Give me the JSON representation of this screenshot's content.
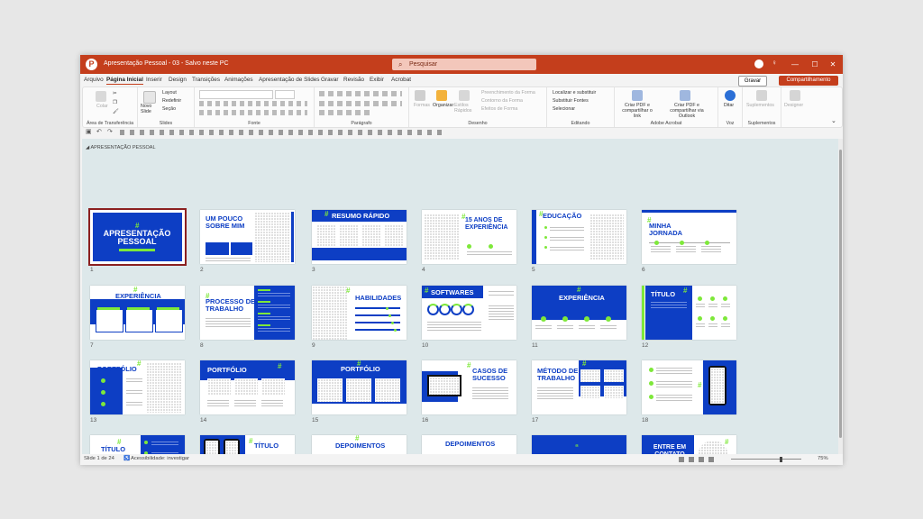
{
  "app": {
    "logo_glyph": "P",
    "title": "Apresentação Pessoal - 03 - Salvo neste PC",
    "search_placeholder": "Pesquisar",
    "window_controls": [
      "—",
      "☐",
      "✕"
    ]
  },
  "menu": {
    "items": [
      "Arquivo",
      "Página Inicial",
      "Inserir",
      "Design",
      "Transições",
      "Animações",
      "Apresentação de Slides",
      "Gravar",
      "Revisão",
      "Exibir",
      "Acrobat"
    ],
    "active": "Página Inicial",
    "record_label": "Gravar",
    "share_label": "Compartilhamento"
  },
  "ribbon": {
    "groups": [
      {
        "label": "Área de Transferência",
        "items": [
          "Colar"
        ]
      },
      {
        "label": "Slides",
        "items": [
          "Novo Slide",
          "Layout",
          "Redefinir",
          "Seção"
        ]
      },
      {
        "label": "Fonte",
        "items": []
      },
      {
        "label": "Parágrafo",
        "items": []
      },
      {
        "label": "Desenho",
        "items": [
          "Formas",
          "Organizar",
          "Estilos Rápidos",
          "Preenchimento da Forma",
          "Contorno da Forma",
          "Efeitos de Forma"
        ]
      },
      {
        "label": "Editando",
        "items": [
          "Localizar e substituir",
          "Substituir Fontes",
          "Selecionar"
        ]
      },
      {
        "label": "Adobe Acrobat",
        "items": [
          "Criar PDF e compartilhar o link",
          "Criar PDF e compartilhar via Outlook"
        ]
      },
      {
        "label": "Voz",
        "items": [
          "Ditar"
        ]
      },
      {
        "label": "Suplementos",
        "items": [
          "Suplementos"
        ]
      },
      {
        "label": "",
        "items": [
          "Designer"
        ]
      }
    ]
  },
  "section_title": "APRESENTAÇÃO PESSOAL",
  "slides": [
    {
      "n": "1",
      "title": "APRESENTAÇÃO PESSOAL"
    },
    {
      "n": "2",
      "title": "UM POUCO SOBRE MIM"
    },
    {
      "n": "3",
      "title": "RESUMO RÁPIDO"
    },
    {
      "n": "4",
      "title": "15 ANOS DE EXPERIÊNCIA"
    },
    {
      "n": "5",
      "title": "EDUCAÇÃO"
    },
    {
      "n": "6",
      "title": "MINHA JORNADA"
    },
    {
      "n": "7",
      "title": "EXPERIÊNCIA"
    },
    {
      "n": "8",
      "title": "PROCESSO DE TRABALHO"
    },
    {
      "n": "9",
      "title": "HABILIDADES"
    },
    {
      "n": "10",
      "title": "SOFTWARES"
    },
    {
      "n": "11",
      "title": "EXPERIÊNCIA"
    },
    {
      "n": "12",
      "title": "TÍTULO"
    },
    {
      "n": "13",
      "title": "PORTFÓLIO"
    },
    {
      "n": "14",
      "title": "PORTFÓLIO"
    },
    {
      "n": "15",
      "title": "PORTFÓLIO"
    },
    {
      "n": "16",
      "title": "CASOS DE SUCESSO"
    },
    {
      "n": "17",
      "title": "MÉTODO DE TRABALHO"
    },
    {
      "n": "18",
      "title": ""
    },
    {
      "n": "19",
      "title": "TÍTULO"
    },
    {
      "n": "20",
      "title": "TÍTULO"
    },
    {
      "n": "21",
      "title": "DEPOIMENTOS"
    },
    {
      "n": "22",
      "title": "DEPOIMENTOS"
    },
    {
      "n": "23",
      "title": ""
    },
    {
      "n": "24",
      "title": "ENTRE EM CONTATO COMIGO!"
    }
  ],
  "status": {
    "slide_info": "Slide 1 de 24",
    "accessibility": "Acessibilidade: investigar",
    "zoom": "75%"
  },
  "colors": {
    "titlebar": "#c43e1c",
    "slide_blue": "#0d3ec4",
    "accent_green": "#7ee83a"
  }
}
